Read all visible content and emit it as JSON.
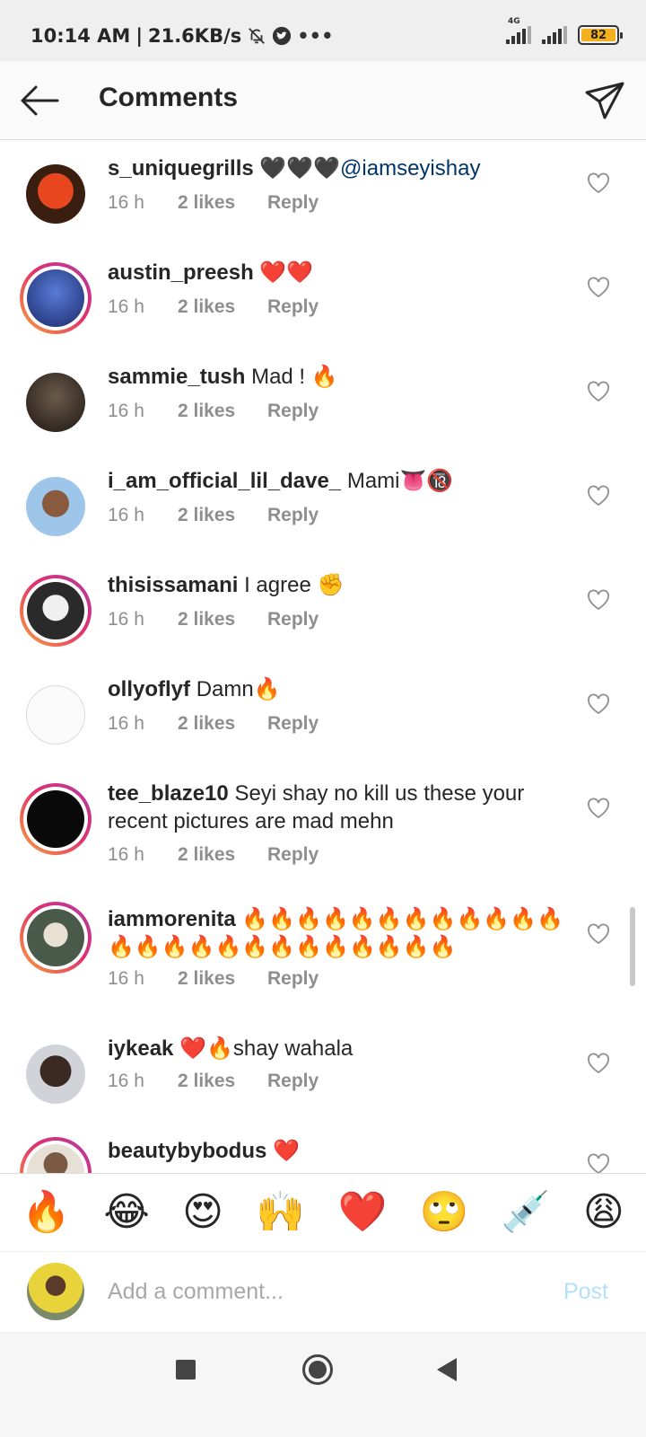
{
  "status_bar": {
    "time": "10:14 AM",
    "separator": "|",
    "speed": "21.6KB/s",
    "network_label": "4G",
    "battery": "82"
  },
  "header": {
    "title": "Comments"
  },
  "comments": [
    {
      "user": "s_uniquegrills",
      "text": "🖤🖤🖤",
      "mention": "@iamseyishay",
      "time": "16 h",
      "likes": "2 likes",
      "reply": "Reply"
    },
    {
      "user": "austin_preesh",
      "text": "❤️❤️",
      "time": "16 h",
      "likes": "2 likes",
      "reply": "Reply"
    },
    {
      "user": "sammie_tush",
      "text": "Mad ! 🔥",
      "time": "16 h",
      "likes": "2 likes",
      "reply": "Reply"
    },
    {
      "user": "i_am_official_lil_dave_",
      "text": "Mami👅🔞",
      "time": "16 h",
      "likes": "2 likes",
      "reply": "Reply"
    },
    {
      "user": "thisissamani",
      "text": "I agree ✊",
      "time": "16 h",
      "likes": "2 likes",
      "reply": "Reply"
    },
    {
      "user": "ollyoflyf",
      "text": "Damn🔥",
      "time": "16 h",
      "likes": "2 likes",
      "reply": "Reply"
    },
    {
      "user": "tee_blaze10",
      "text": "Seyi shay no kill us these your recent pictures are mad mehn",
      "time": "16 h",
      "likes": "2 likes",
      "reply": "Reply"
    },
    {
      "user": "iammorenita",
      "text": "🔥🔥🔥🔥🔥🔥🔥🔥🔥🔥🔥🔥🔥🔥🔥🔥🔥🔥🔥🔥🔥🔥🔥🔥🔥",
      "time": "16 h",
      "likes": "2 likes",
      "reply": "Reply"
    },
    {
      "user": "iykeak",
      "text": "❤️🔥shay wahala",
      "time": "16 h",
      "likes": "2 likes",
      "reply": "Reply"
    },
    {
      "user": "beautybybodus",
      "text": "❤️"
    }
  ],
  "emoji_bar": [
    "🔥",
    "😂",
    "😍",
    "🙌",
    "❤️",
    "🙄",
    "💉",
    "😩"
  ],
  "composer": {
    "placeholder": "Add a comment...",
    "post_label": "Post"
  },
  "icons": {
    "back": "arrow-left-icon",
    "share": "paper-plane-icon",
    "like": "heart-outline-icon"
  }
}
